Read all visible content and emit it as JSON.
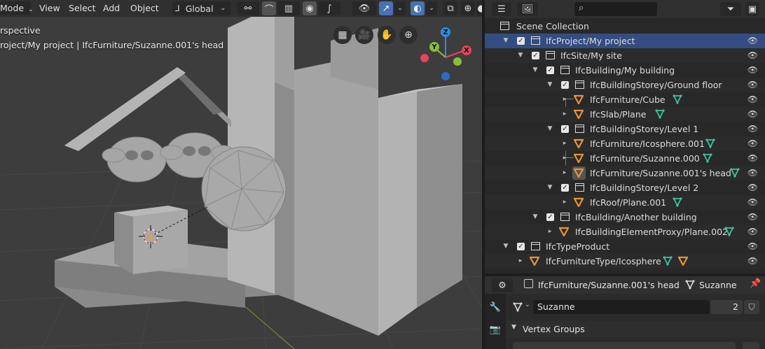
{
  "viewport": {
    "menu": {
      "mode": "Mode",
      "view": "View",
      "select": "Select",
      "add": "Add",
      "object": "Object",
      "orientation": "Global"
    },
    "overlay": {
      "perspective": "rspective",
      "breadcrumb": "roject/My project | IfcFurniture/Suzanne.001's head"
    },
    "gizmo": {
      "z": "Z",
      "y": "Y",
      "x": "X"
    }
  },
  "outliner": {
    "search_placeholder": "",
    "scene_collection": "Scene Collection",
    "rows": [
      {
        "label": "IfcProject/My project"
      },
      {
        "label": "IfcSite/My site"
      },
      {
        "label": "IfcBuilding/My building"
      },
      {
        "label": "IfcBuildingStorey/Ground floor"
      },
      {
        "label": "IfcFurniture/Cube"
      },
      {
        "label": "IfcSlab/Plane"
      },
      {
        "label": "IfcBuildingStorey/Level 1"
      },
      {
        "label": "IfcFurniture/Icosphere.001"
      },
      {
        "label": "IfcFurniture/Suzanne.000"
      },
      {
        "label": "IfcFurniture/Suzanne.001's head"
      },
      {
        "label": "IfcBuildingStorey/Level 2"
      },
      {
        "label": "IfcRoof/Plane.001"
      },
      {
        "label": "IfcBuilding/Another building"
      },
      {
        "label": "IfcBuildingElementProxy/Plane.002"
      },
      {
        "label": "IfcTypeProduct"
      },
      {
        "label": "IfcFurnitureType/Icosphere"
      }
    ]
  },
  "properties": {
    "object_name": "IfcFurniture/Suzanne.001's head",
    "mesh_name": "Suzanne",
    "datablock_name": "Suzanne",
    "user_count": "2",
    "section_vertex_groups": "Vertex Groups"
  },
  "colors": {
    "accent": "#4772b3",
    "selected_row": "#334d80",
    "mesh_icon": "#40c0a0",
    "object_icon": "#e8933a",
    "axis_x": "#e6445f",
    "axis_y": "#86c03a",
    "axis_z": "#2d8ee8"
  }
}
